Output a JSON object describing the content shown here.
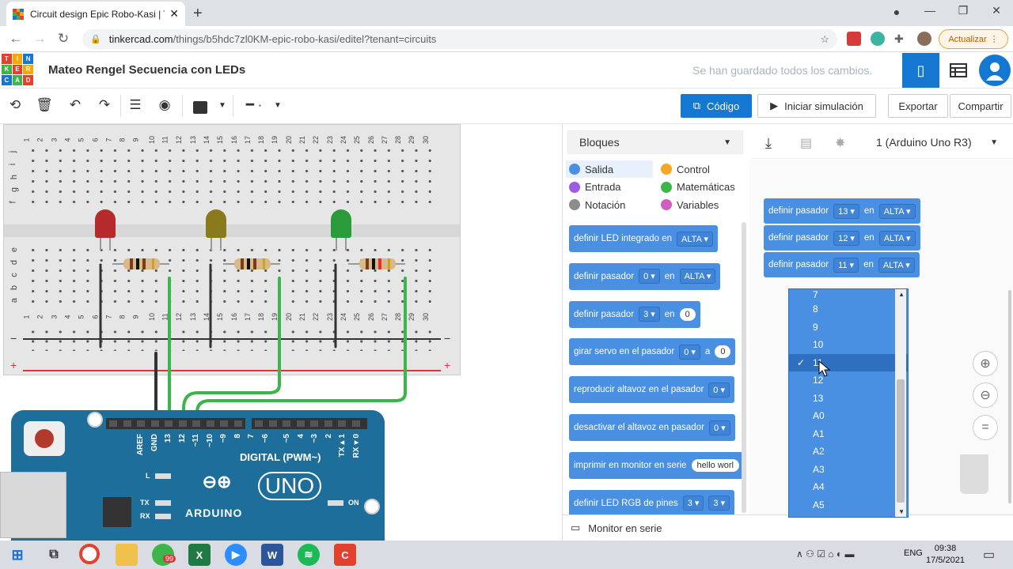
{
  "browser": {
    "tab_title": "Circuit design Epic Robo-Kasi | Ti",
    "url_host": "tinkercad.com",
    "url_path": "/things/b5hdc7zl0KM-epic-robo-kasi/editel?tenant=circuits",
    "update_label": "Actualizar"
  },
  "header": {
    "logo_letters": [
      "TIN",
      "KER",
      "CAD"
    ],
    "project_title": "Mateo Rengel Secuencia con LEDs",
    "save_status": "Se han guardado todos los cambios."
  },
  "toolbar": {
    "code_label": "Código",
    "simulate_label": "Iniciar simulación",
    "export_label": "Exportar",
    "share_label": "Compartir"
  },
  "code_panel": {
    "mode_select": "Bloques",
    "device_select": "1 (Arduino Uno R3)",
    "categories": [
      {
        "label": "Salida",
        "color": "#4a90e2"
      },
      {
        "label": "Control",
        "color": "#f5a623"
      },
      {
        "label": "Entrada",
        "color": "#9b5de5"
      },
      {
        "label": "Matemáticas",
        "color": "#3cb54a"
      },
      {
        "label": "Notación",
        "color": "#8c8c8c"
      },
      {
        "label": "Variables",
        "color": "#d05dbf"
      }
    ],
    "palette_blocks": [
      {
        "text": "definir LED integrado en",
        "d1": "ALTA"
      },
      {
        "text": "definir pasador",
        "d1": "0",
        "mid": "en",
        "d2": "ALTA"
      },
      {
        "text": "definir pasador",
        "d1": "3",
        "mid": "en",
        "v": "0"
      },
      {
        "text": "girar servo en el pasador",
        "d1": "0",
        "mid": "a",
        "v": "0"
      },
      {
        "text": "reproducir altavoz en el pasador",
        "d1": "0"
      },
      {
        "text": "desactivar el altavoz en pasador",
        "d1": "0"
      },
      {
        "text": "imprimir en monitor en serie",
        "v": "hello worl"
      },
      {
        "text": "definir LED RGB de pines",
        "d1": "3",
        "d2": "3"
      }
    ],
    "workspace_blocks": [
      {
        "text": "definir pasador",
        "pin": "13",
        "mid": "en",
        "state": "ALTA"
      },
      {
        "text": "definir pasador",
        "pin": "12",
        "mid": "en",
        "state": "ALTA"
      },
      {
        "text": "definir pasador",
        "pin": "11",
        "mid": "en",
        "state": "ALTA"
      }
    ],
    "dropdown_options": [
      "7",
      "8",
      "9",
      "10",
      "11",
      "12",
      "13",
      "A0",
      "A1",
      "A2",
      "A3",
      "A4",
      "A5"
    ],
    "dropdown_selected": "11",
    "serial_monitor": "Monitor en serie"
  },
  "board": {
    "digital_label": "DIGITAL (PWM~)",
    "arduino_label": "ARDUINO",
    "uno_label": "UNO",
    "pin_labels": [
      "AREF",
      "GND",
      "13",
      "12",
      "~11",
      "~10",
      "~9",
      "8",
      "7",
      "~6",
      "~5",
      "4",
      "~3",
      "2",
      "TX▸1",
      "RX◂0"
    ],
    "side_labels": [
      "L",
      "TX",
      "RX",
      "ON"
    ],
    "row_numbers_top": [
      "1",
      "2",
      "3",
      "4",
      "5",
      "6",
      "7",
      "8",
      "9",
      "10",
      "11",
      "12",
      "13",
      "14",
      "15",
      "16",
      "17",
      "18",
      "19",
      "20",
      "21",
      "22",
      "23",
      "24",
      "25",
      "26",
      "27",
      "28",
      "29",
      "30"
    ],
    "row_letters_top": [
      "j",
      "i",
      "h",
      "g",
      "f"
    ],
    "row_letters_bottom": [
      "e",
      "d",
      "c",
      "b",
      "a"
    ],
    "rail_minus": "−",
    "rail_plus": "+",
    "leds": [
      {
        "color": "#b52a2a"
      },
      {
        "color": "#8a7a1e"
      },
      {
        "color": "#2a9a3a"
      }
    ]
  },
  "taskbar": {
    "time": "09:38",
    "date": "17/5/2021",
    "lang": "ENG",
    "whatsapp_badge": "99"
  }
}
